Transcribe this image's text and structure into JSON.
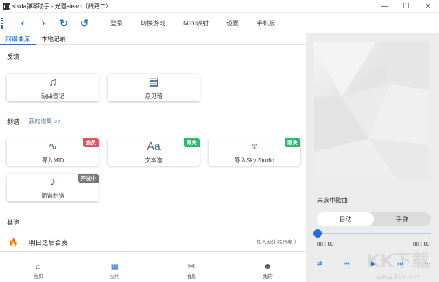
{
  "window": {
    "title": "shida弹琴助手 - 光遇steam（线路二）",
    "minimize": "—",
    "maximize": "☐",
    "close": "✕"
  },
  "toolbar": {
    "back_icon": "‹",
    "forward_icon": "›",
    "refresh_icon": "↻",
    "sync_icon": "↺",
    "menu": [
      "登录",
      "切换游戏",
      "MIDI映射",
      "设置",
      "手机版"
    ]
  },
  "tabs": [
    {
      "label": "网络曲库",
      "active": true
    },
    {
      "label": "本地记录",
      "active": false
    }
  ],
  "feedback": {
    "title": "反馈",
    "cards": [
      {
        "label": "缺曲登记",
        "icon": "music-note-icon",
        "glyph": "♫"
      },
      {
        "label": "意见箱",
        "icon": "inbox-icon",
        "glyph": "▤"
      }
    ]
  },
  "score_making": {
    "title": "制谱",
    "link": "我的谱集 >>",
    "cards": [
      {
        "label": "导入MID",
        "icon": "waveform-icon",
        "glyph": "∿",
        "badge": "会员",
        "badge_color": "#e05561"
      },
      {
        "label": "文本谱",
        "icon": "text-icon",
        "glyph": "Aa",
        "badge": "限免",
        "badge_color": "#2fb86b"
      },
      {
        "label": "导入Sky Studio",
        "icon": "lyre-icon",
        "glyph": "♆",
        "badge": "限免",
        "badge_color": "#2fb86b"
      },
      {
        "label": "简谱制谱",
        "icon": "music-note-icon",
        "glyph": "♪",
        "badge": "开发中",
        "badge_color": "#777777"
      }
    ]
  },
  "other": {
    "title": "其他",
    "items": [
      {
        "title": "明日之后合奏",
        "action": "加入新乐器合奏 〉",
        "icon": "flame-icon"
      }
    ]
  },
  "bottom_nav": [
    {
      "label": "首页",
      "glyph": "⌂",
      "icon": "home-icon",
      "active": false
    },
    {
      "label": "应用",
      "glyph": "▦",
      "icon": "apps-icon",
      "active": true
    },
    {
      "label": "消息",
      "glyph": "✉",
      "icon": "message-icon",
      "active": false
    },
    {
      "label": "我的",
      "glyph": "☻",
      "icon": "profile-icon",
      "active": false
    }
  ],
  "player": {
    "song": "未选中歌曲",
    "modes": [
      "自动",
      "手弹"
    ],
    "active_mode": "自动",
    "progress": 0,
    "current_time": "00 : 00",
    "total_time": "00 : 00",
    "controls": [
      "⇄",
      "⏮",
      "▶",
      "⏭",
      "⋯"
    ]
  },
  "colors": {
    "accent": "#1e6fd9",
    "nav_active": "#4a7cc0"
  }
}
